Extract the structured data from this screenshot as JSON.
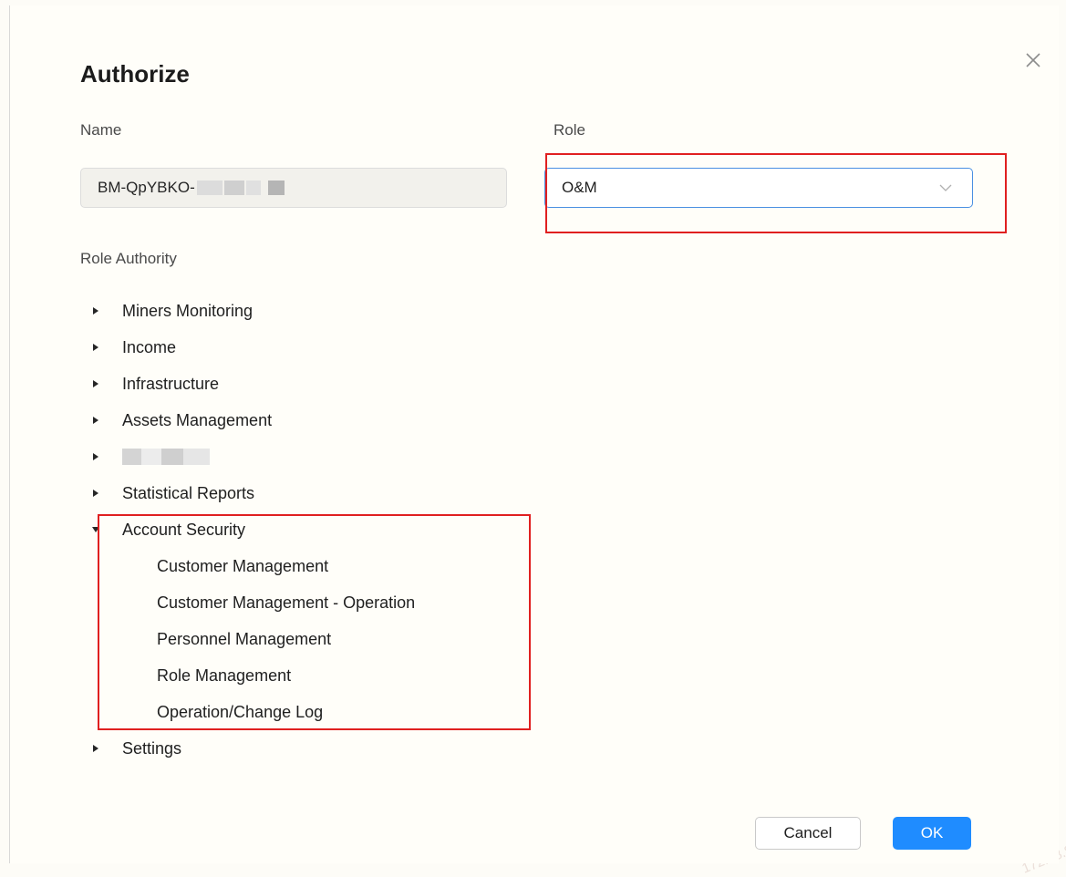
{
  "dialog": {
    "title": "Authorize",
    "name_label": "Name",
    "name_value": "BM-QpYBKO-",
    "role_label": "Role",
    "role_value": "O&M",
    "role_authority_label": "Role Authority",
    "tree": [
      {
        "label": "Miners Monitoring",
        "expanded": false
      },
      {
        "label": "Income",
        "expanded": false
      },
      {
        "label": "Infrastructure",
        "expanded": false
      },
      {
        "label": "Assets Management",
        "expanded": false
      },
      {
        "label": "",
        "expanded": false,
        "redacted": true
      },
      {
        "label": "Statistical Reports",
        "expanded": false
      },
      {
        "label": "Account Security",
        "expanded": true,
        "children": [
          "Customer Management",
          "Customer Management - Operation",
          "Personnel Management",
          "Role Management",
          "Operation/Change Log"
        ]
      },
      {
        "label": "Settings",
        "expanded": false
      }
    ],
    "cancel_label": "Cancel",
    "ok_label": "OK"
  },
  "watermark": {
    "ip": "172.28.89.122",
    "date": "2024-03-20",
    "mac": "F0-18-98-3B-18-47"
  },
  "colors": {
    "accent": "#1f8cff",
    "highlight_box": "#e02020",
    "select_border": "#4a90e2"
  },
  "icons": {
    "close": "close-icon",
    "select": "chevron-down-icon",
    "collapsed": "caret-right-icon",
    "expanded": "caret-down-icon"
  }
}
